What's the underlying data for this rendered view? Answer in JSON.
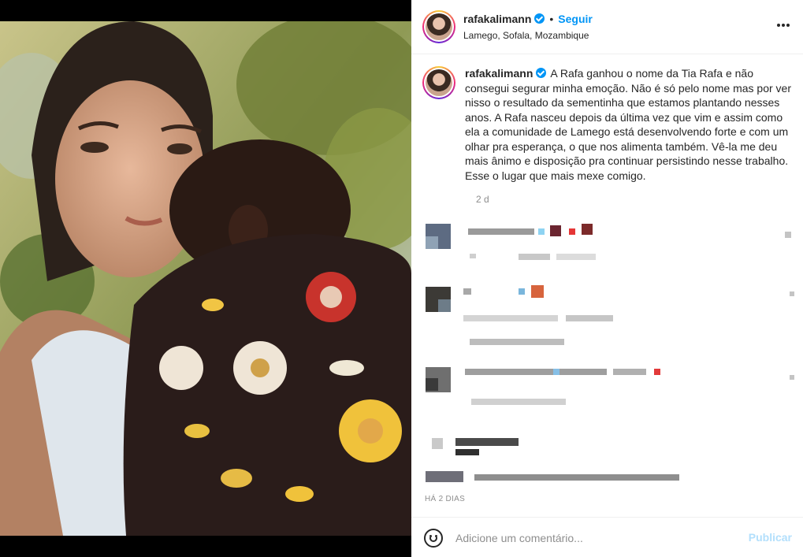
{
  "post": {
    "username": "rafakalimann",
    "follow_separator": "•",
    "follow_label": "Seguir",
    "location": "Lamego, Sofala, Mozambique",
    "more_label": "•••",
    "caption": "A Rafa ganhou o nome da Tia Rafa e não consegui segurar minha emoção. Não é só pelo nome mas por ver nisso o resultado da sementinha que estamos plantando nesses anos. A Rafa nasceu depois da última vez que vim e assim como ela a comunidade de Lamego está desenvolvendo forte e com um olhar pra esperança, o que nos alimenta também. Vê-la me deu mais ânimo e disposição pra continuar persistindo nesse trabalho. Esse o lugar que mais mexe comigo.",
    "caption_age": "2 d",
    "date": "HÁ 2 DIAS"
  },
  "comment_bar": {
    "placeholder": "Adicione um comentário...",
    "publish_label": "Publicar"
  },
  "icons": {
    "verified": "verified-badge-icon",
    "more": "more-options-icon",
    "emoji": "emoji-smiley-icon"
  },
  "colors": {
    "accent": "#0095f6",
    "publish_disabled": "#b2dffc",
    "muted": "#8e8e8e"
  }
}
